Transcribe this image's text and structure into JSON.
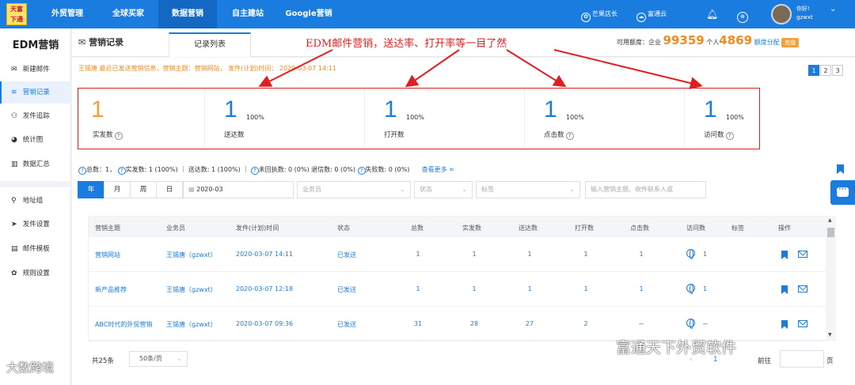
{
  "logo": {
    "line1": "天富",
    "line2": "下通"
  },
  "nav": {
    "items": [
      "外贸管理",
      "全球买家",
      "数据营销",
      "自主建站",
      "Google营销"
    ],
    "active_index": 2,
    "store": "芒果店长",
    "cloud": "富通云",
    "greet": "你好!",
    "username": "gzwxt"
  },
  "sidebar": {
    "title": "EDM营销",
    "items": [
      {
        "label": "新建邮件",
        "icon": "envelope-icon",
        "glyph": "✉"
      },
      {
        "label": "营销记录",
        "icon": "layers-icon",
        "glyph": "≋"
      },
      {
        "label": "发件追踪",
        "icon": "binoculars-icon",
        "glyph": "⚇"
      },
      {
        "label": "统计图",
        "icon": "pie-chart-icon",
        "glyph": "◕"
      },
      {
        "label": "数据汇总",
        "icon": "bar-chart-icon",
        "glyph": "▥"
      },
      {
        "label": "地址组",
        "icon": "map-pin-icon",
        "glyph": "⚲"
      },
      {
        "label": "发件设置",
        "icon": "send-icon",
        "glyph": "➤"
      },
      {
        "label": "邮件模板",
        "icon": "template-icon",
        "glyph": "▤"
      },
      {
        "label": "规则设置",
        "icon": "gear-icon",
        "glyph": "✿"
      }
    ],
    "active_index": 1
  },
  "header": {
    "title": "营销记录",
    "tab": "记录列表",
    "annotation": "EDM邮件营销，送达率、打开率等一目了然",
    "quota_label": "可用额度：企业",
    "quota_enterprise": "99359",
    "quota_personal_label": "个人",
    "quota_personal": "4869",
    "quota_link": "额度分配",
    "recharge": "充值"
  },
  "notice": "王锡唐 最近已发送营销信息，营销主题：营销网站，  发件(计划)时间：  2020-03-07 14:11",
  "pager_top": [
    "1",
    "2",
    "3"
  ],
  "stats": [
    {
      "value": "1",
      "pct": "",
      "label": "实发数",
      "help": true,
      "color": "orange"
    },
    {
      "value": "1",
      "pct": "100%",
      "label": "送达数",
      "help": false,
      "color": "blue"
    },
    {
      "value": "1",
      "pct": "100%",
      "label": "打开数",
      "help": false,
      "color": "blue"
    },
    {
      "value": "1",
      "pct": "100%",
      "label": "点击数",
      "help": true,
      "color": "blue"
    },
    {
      "value": "1",
      "pct": "100%",
      "label": "访问数",
      "help": true,
      "color": "blue"
    }
  ],
  "summary": {
    "total": "总数：1，",
    "sent": "实发数: 1 (100%)",
    "delivered": "送达数: 1 (100%)",
    "unreturned": "未回执数: 0 (0%)",
    "bounced": "退信数: 0 (0%)",
    "failed": "失败数: 0 (0%)",
    "more": "查看更多 ≈"
  },
  "filters": {
    "periods": [
      "年",
      "月",
      "周",
      "日"
    ],
    "active_period": 0,
    "date": "2020-03",
    "salesperson": "业务员",
    "status": "状态",
    "tag": "标签",
    "search_placeholder": "输入营销主题、收件联系人或"
  },
  "table": {
    "headers": [
      "营销主题",
      "业务员",
      "发件(计划)时间",
      "状态",
      "总数",
      "实发数",
      "送达数",
      "打开数",
      "点击数",
      "访问数",
      "标签",
      "操作"
    ],
    "rows": [
      {
        "subject": "营销网站",
        "agent": "王锡唐（gzwxt）",
        "time": "2020-03-07 14:11",
        "status": "已发送",
        "total": "1",
        "sent": "1",
        "delivered": "1",
        "opened": "1",
        "clicked": "1",
        "visits": "1"
      },
      {
        "subject": "新产品推荐",
        "agent": "王锡唐（gzwxt）",
        "time": "2020-03-07 12:18",
        "status": "已发送",
        "total": "1",
        "sent": "1",
        "delivered": "1",
        "opened": "1",
        "clicked": "1",
        "visits": "1"
      },
      {
        "subject": "ABC时代的外贸营销",
        "agent": "王锡唐（gzwxt）",
        "time": "2020-03-07 09:36",
        "status": "已发送",
        "total": "31",
        "sent": "28",
        "delivered": "27",
        "opened": "2",
        "clicked": "--",
        "visits": "--"
      }
    ]
  },
  "footer": {
    "total": "共25条",
    "page_size": "50条/页",
    "current_page": "1",
    "goto_label": "前往",
    "page_unit": "页"
  },
  "watermarks": {
    "left": "大数跨境",
    "right": "富通天下外贸软件"
  },
  "colors": {
    "primary": "#1b7ce0",
    "accent": "#f08a1c",
    "annotation": "#e02020"
  }
}
